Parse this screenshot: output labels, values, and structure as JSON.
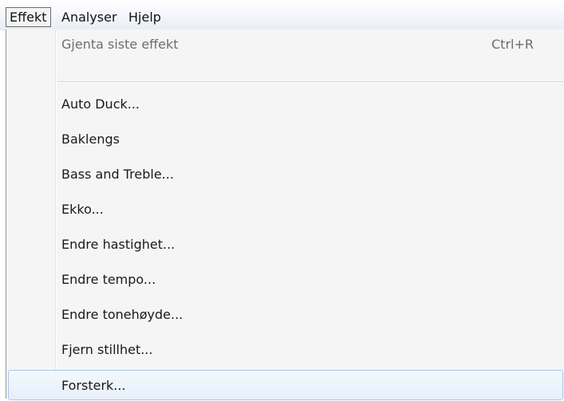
{
  "menubar": {
    "items": [
      {
        "label": "Effekt"
      },
      {
        "label": "Analyser"
      },
      {
        "label": "Hjelp"
      }
    ]
  },
  "menu": {
    "repeat_last": {
      "label": "Gjenta siste effekt",
      "shortcut": "Ctrl+R"
    },
    "items": [
      {
        "label": "Auto Duck..."
      },
      {
        "label": "Baklengs"
      },
      {
        "label": "Bass and Treble..."
      },
      {
        "label": "Ekko..."
      },
      {
        "label": "Endre hastighet..."
      },
      {
        "label": "Endre tempo..."
      },
      {
        "label": "Endre tonehøyde..."
      },
      {
        "label": "Fjern stillhet..."
      },
      {
        "label": "Forsterk..."
      }
    ]
  }
}
